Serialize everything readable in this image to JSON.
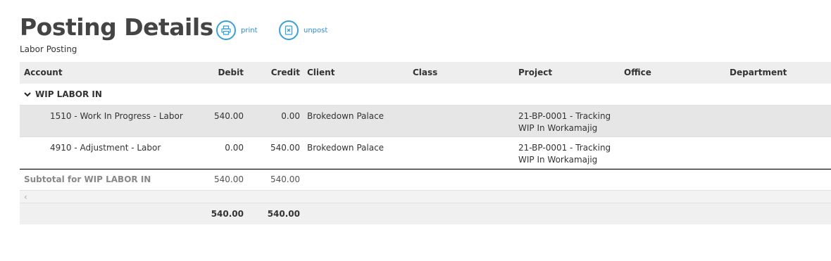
{
  "page": {
    "title": "Posting Details",
    "subtitle": "Labor Posting"
  },
  "actions": {
    "print_label": "print",
    "unpost_label": "unpost"
  },
  "columns": {
    "account": "Account",
    "debit": "Debit",
    "credit": "Credit",
    "client": "Client",
    "class": "Class",
    "project": "Project",
    "office": "Office",
    "department": "Department"
  },
  "group": {
    "name": "WIP LABOR IN",
    "rows": [
      {
        "account": "1510 - Work In Progress - Labor",
        "debit": "540.00",
        "credit": "0.00",
        "client": "Brokedown Palace",
        "project_line1": "21-BP-0001 - Tracking",
        "project_line2": "WIP In Workamajig"
      },
      {
        "account": "4910 - Adjustment - Labor",
        "debit": "0.00",
        "credit": "540.00",
        "client": "Brokedown Palace",
        "project_line1": "21-BP-0001 - Tracking",
        "project_line2": "WIP In Workamajig"
      }
    ],
    "subtotal_label": "Subtotal for WIP LABOR IN",
    "subtotal_debit": "540.00",
    "subtotal_credit": "540.00"
  },
  "scroll_left_glyph": "‹",
  "totals": {
    "debit": "540.00",
    "credit": "540.00"
  },
  "colors": {
    "accent": "#3aa0d8",
    "link": "#2a8cc7",
    "header_bg": "#eeeeee",
    "selected_row_bg": "#e6e6e6"
  }
}
